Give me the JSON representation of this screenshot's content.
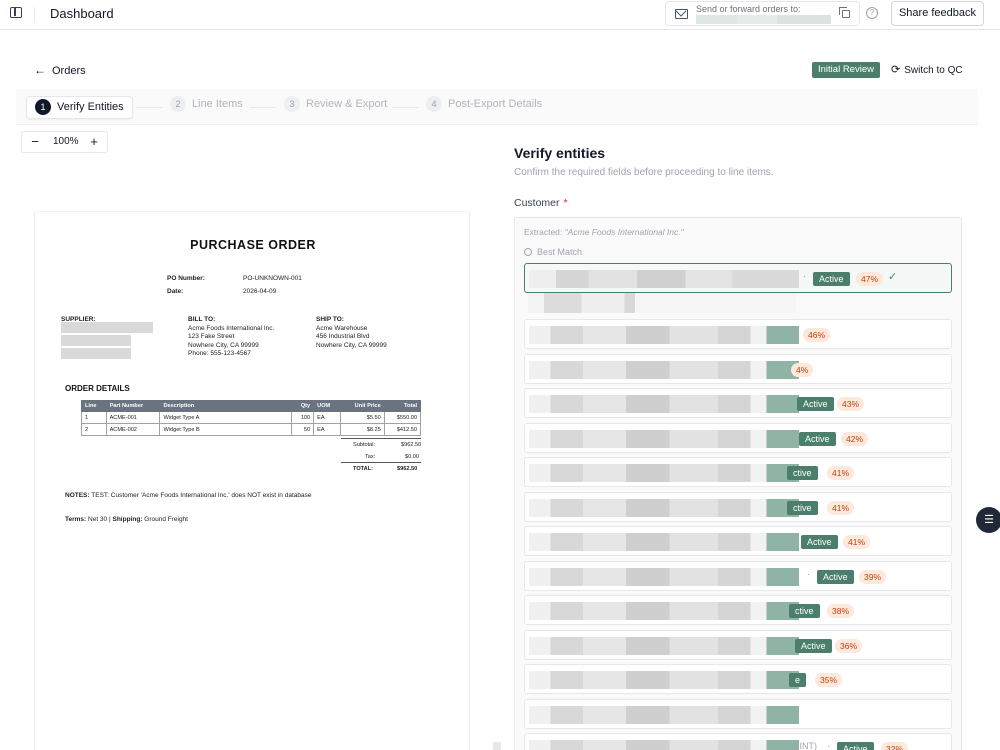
{
  "app": {
    "title": "Dashboard"
  },
  "topbar": {
    "email_label": "Send or forward orders to:",
    "share_label": "Share feedback",
    "help_glyph": "?"
  },
  "header": {
    "back_label": "Orders",
    "status": "Initial Review",
    "switch_label": "Switch to QC"
  },
  "stepper": [
    {
      "num": "1",
      "label": "Verify Entities"
    },
    {
      "num": "2",
      "label": "Line Items"
    },
    {
      "num": "3",
      "label": "Review & Export"
    },
    {
      "num": "4",
      "label": "Post-Export Details"
    }
  ],
  "zoom": {
    "minus": "−",
    "value": "100%",
    "plus": "+"
  },
  "document": {
    "title": "PURCHASE ORDER",
    "po_number_label": "PO Number:",
    "po_number": "PO-UNKNOWN-001",
    "date_label": "Date:",
    "date": "2026-04-09",
    "supplier_label": "SUPPLIER:",
    "bill_to_label": "BILL TO:",
    "bill_to": [
      "Acme Foods International Inc.",
      "123 Fake Street",
      "Nowhere City, CA 99999",
      "Phone: 555-123-4567"
    ],
    "ship_to_label": "SHIP TO:",
    "ship_to": [
      "Acme Warehouse",
      "456 Industrial Blvd",
      "Nowhere City, CA 99999"
    ],
    "order_details_label": "ORDER DETAILS",
    "table_headers": [
      "Line",
      "Part Number",
      "Description",
      "Qty",
      "UOM",
      "Unit Price",
      "Total"
    ],
    "table_rows": [
      [
        "1",
        "ACME-001",
        "Widget Type A",
        "100",
        "EA",
        "$5.50",
        "$550.00"
      ],
      [
        "2",
        "ACME-002",
        "Widget Type B",
        "50",
        "EA",
        "$8.25",
        "$412.50"
      ]
    ],
    "subtotal_label": "Subtotal:",
    "subtotal": "$962.50",
    "tax_label": "Tax:",
    "tax": "$0.00",
    "total_label": "TOTAL:",
    "total": "$962.50",
    "notes_label": "NOTES:",
    "notes": "TEST: Customer 'Acme Foods International Inc.' does NOT exist in database",
    "terms_label": "Terms:",
    "terms": "Net 30",
    "shipping_label": "Shipping:",
    "shipping": "Ground Freight"
  },
  "panel": {
    "title": "Verify entities",
    "subtitle": "Confirm the required fields before proceeding to line items.",
    "customer_label": "Customer",
    "required_mark": "*",
    "extracted_label": "Extracted:",
    "extracted_value": "\"Acme Foods International Inc.\"",
    "best_match_label": "Best Match"
  },
  "matches": [
    {
      "status": "Active",
      "score": "47%",
      "selected": true
    },
    {
      "status": "",
      "score": "46%"
    },
    {
      "status": "",
      "score": "4%"
    },
    {
      "status": "Active",
      "score": "43%"
    },
    {
      "status": "Active",
      "score": "42%"
    },
    {
      "status": "ctive",
      "score": "41%"
    },
    {
      "status": "ctive",
      "score": "41%"
    },
    {
      "status": "Active",
      "score": "41%"
    },
    {
      "status": "Active",
      "score": "39%"
    },
    {
      "status": "ctive",
      "score": "38%"
    },
    {
      "status": "Active",
      "score": "36%"
    },
    {
      "status": "e",
      "score": "35%"
    },
    {
      "status": "",
      "score": ""
    },
    {
      "status": "Active",
      "score": "32%",
      "suffix": "NINT)"
    }
  ],
  "colors": {
    "accent": "#4b7f6b",
    "score_bg": "#fde8dc",
    "score_text": "#c2410c"
  }
}
